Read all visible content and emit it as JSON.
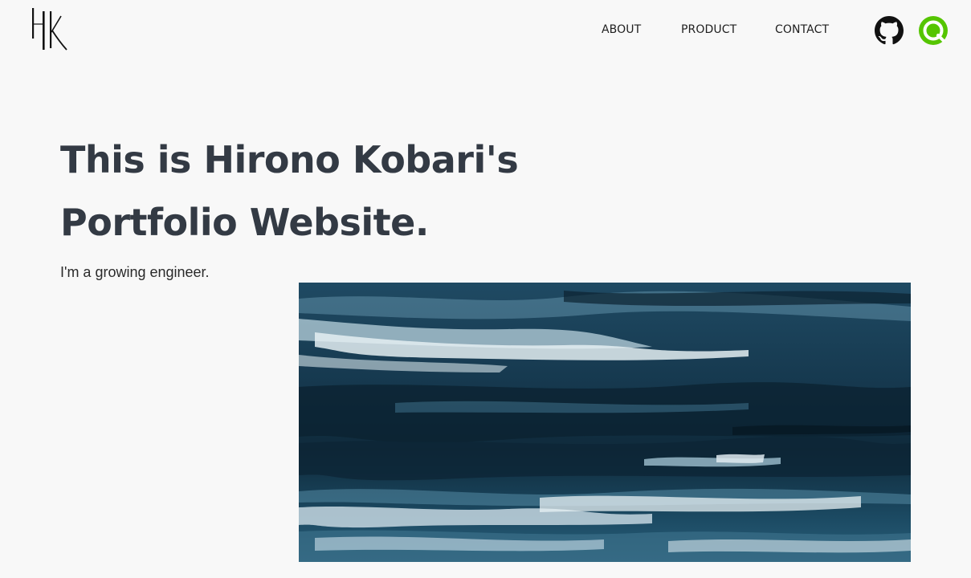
{
  "header": {
    "logo_icon": "hk-monogram-logo",
    "nav": [
      {
        "label": "ABOUT"
      },
      {
        "label": "PRODUCT"
      },
      {
        "label": "CONTACT"
      }
    ],
    "social": {
      "github_icon": "github-icon",
      "qiita_icon": "qiita-icon",
      "qiita_color": "#55c500"
    }
  },
  "hero": {
    "title_line1": "This is Hirono Kobari's",
    "title_line2": "Portfolio Website.",
    "subtitle": "I'm a growing engineer.",
    "image_icon": "abstract-blue-painting",
    "title_color": "#333a44"
  }
}
